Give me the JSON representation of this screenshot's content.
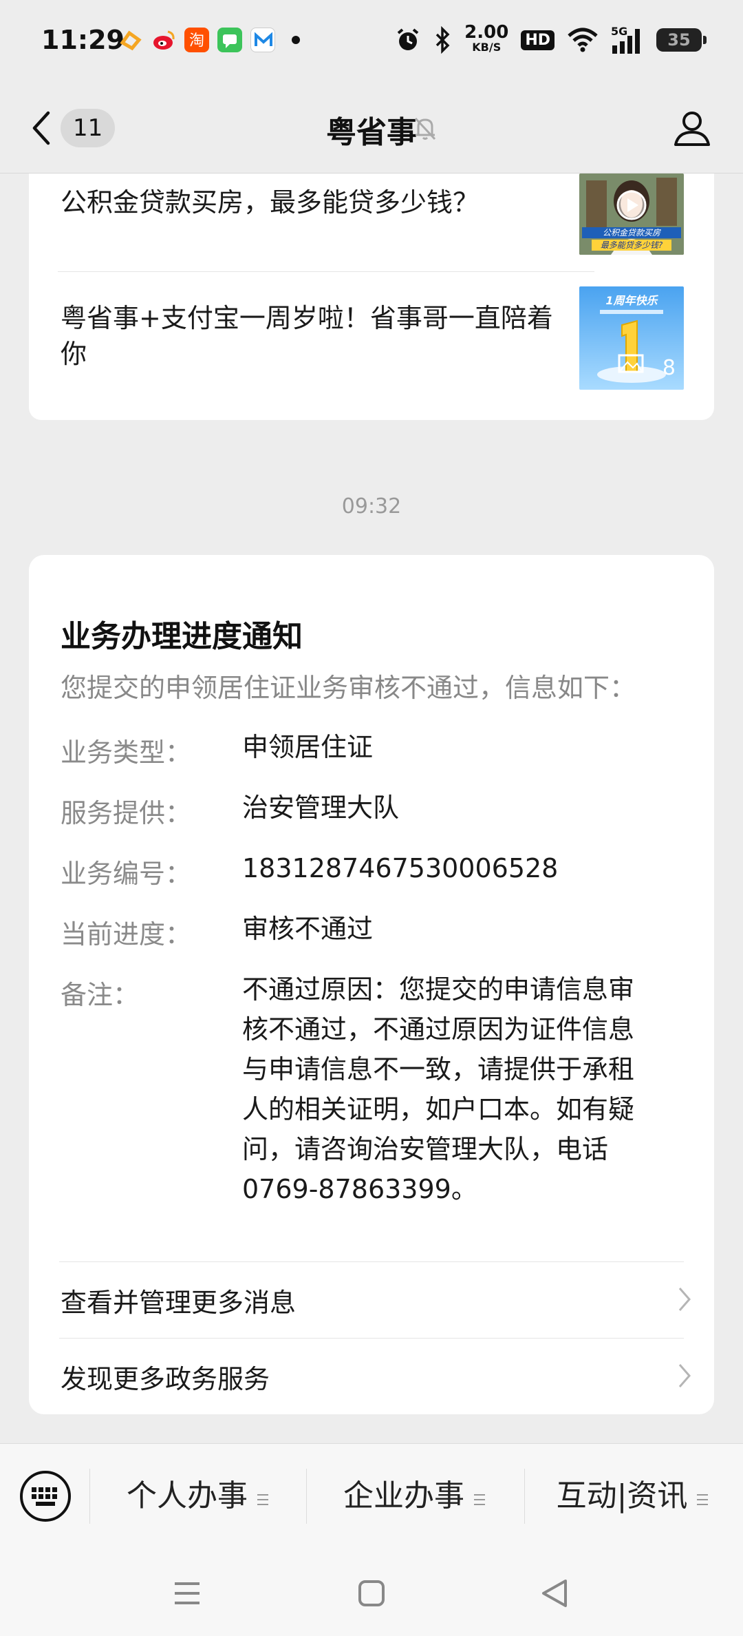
{
  "status_bar": {
    "time": "11:29",
    "net_speed_value": "2.00",
    "net_speed_unit": "KB/S",
    "hd": "HD",
    "network": "5G",
    "battery": "35",
    "icons": [
      "app-a-icon",
      "weibo-icon",
      "taobao-icon",
      "messages-icon",
      "mail-icon",
      "dot-icon",
      "alarm-icon",
      "bluetooth-icon",
      "wifi-icon",
      "signal-icon",
      "battery-icon"
    ]
  },
  "nav": {
    "back_icon": "chevron-left-icon",
    "unread_count": "11",
    "title": "粤省事",
    "mute_icon": "bell-off-icon",
    "profile_icon": "person-icon"
  },
  "article_card": {
    "items": [
      {
        "title": "公积金贷款买房，最多能贷多少钱？",
        "thumb_text": "公积金贷款买房 最多能贷多少钱?"
      },
      {
        "title": "粤省事+支付宝一周岁啦！省事哥一直陪着你",
        "thumb_text": "1周年快乐",
        "thumb_count": "8"
      }
    ]
  },
  "timestamp": "09:32",
  "notice": {
    "title": "业务办理进度通知",
    "intro": "您提交的申领居住证业务审核不通过，信息如下：",
    "fields": [
      {
        "label": "业务类型：",
        "value": "申领居住证"
      },
      {
        "label": "服务提供：",
        "value": "治安管理大队"
      },
      {
        "label": "业务编号：",
        "value": "183128746753000652​8"
      },
      {
        "label": "当前进度：",
        "value": "审核不通过"
      },
      {
        "label": "备注：",
        "value_lines": [
          "不通过原因：您提交的申请信息审",
          "核不通过，不通过原因为证件信息",
          "与申请信息不一致，请提供于承租",
          "人的相关证明，如户口本。如有疑",
          "问，请咨询治安管理大队，电话",
          "0769-87863399。"
        ]
      }
    ],
    "links": [
      "查看并管理更多消息",
      "发现更多政务服务"
    ]
  },
  "bottom_menu": {
    "keyboard_icon": "keyboard-icon",
    "items": [
      "个人办事",
      "企业办事",
      "互动|资讯"
    ]
  },
  "system_nav": [
    "menu-icon",
    "home-icon",
    "back-triangle-icon"
  ]
}
